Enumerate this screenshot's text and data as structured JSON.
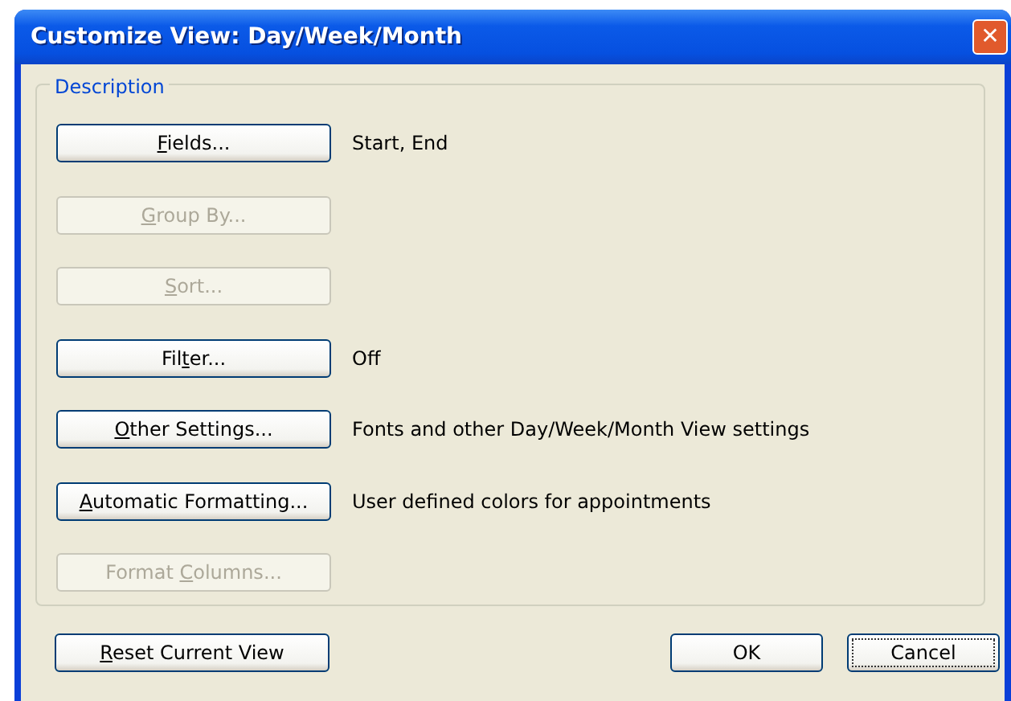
{
  "window": {
    "title": "Customize View: Day/Week/Month",
    "close": "✕"
  },
  "group": {
    "title": "Description"
  },
  "rows": [
    {
      "key": "F",
      "post": "ields...",
      "disabled": false,
      "description": "Start, End"
    },
    {
      "key": "G",
      "post": "roup By...",
      "disabled": true
    },
    {
      "key": "S",
      "post": "ort...",
      "disabled": true
    },
    {
      "pre": "Fil",
      "key": "t",
      "post": "er...",
      "disabled": false,
      "description": "Off"
    },
    {
      "key": "O",
      "post": "ther Settings...",
      "disabled": false,
      "description": "Fonts and other Day/Week/Month View settings"
    },
    {
      "key": "A",
      "post": "utomatic Formatting...",
      "disabled": false,
      "description": "User defined colors for appointments"
    },
    {
      "pre": "Format ",
      "key": "C",
      "post": "olumns...",
      "disabled": true
    }
  ],
  "footer": {
    "reset": {
      "key": "R",
      "post": "eset Current View"
    },
    "buttons": [
      {
        "label": "OK",
        "focused": false
      },
      {
        "label": "Cancel",
        "focused": true
      }
    ]
  }
}
